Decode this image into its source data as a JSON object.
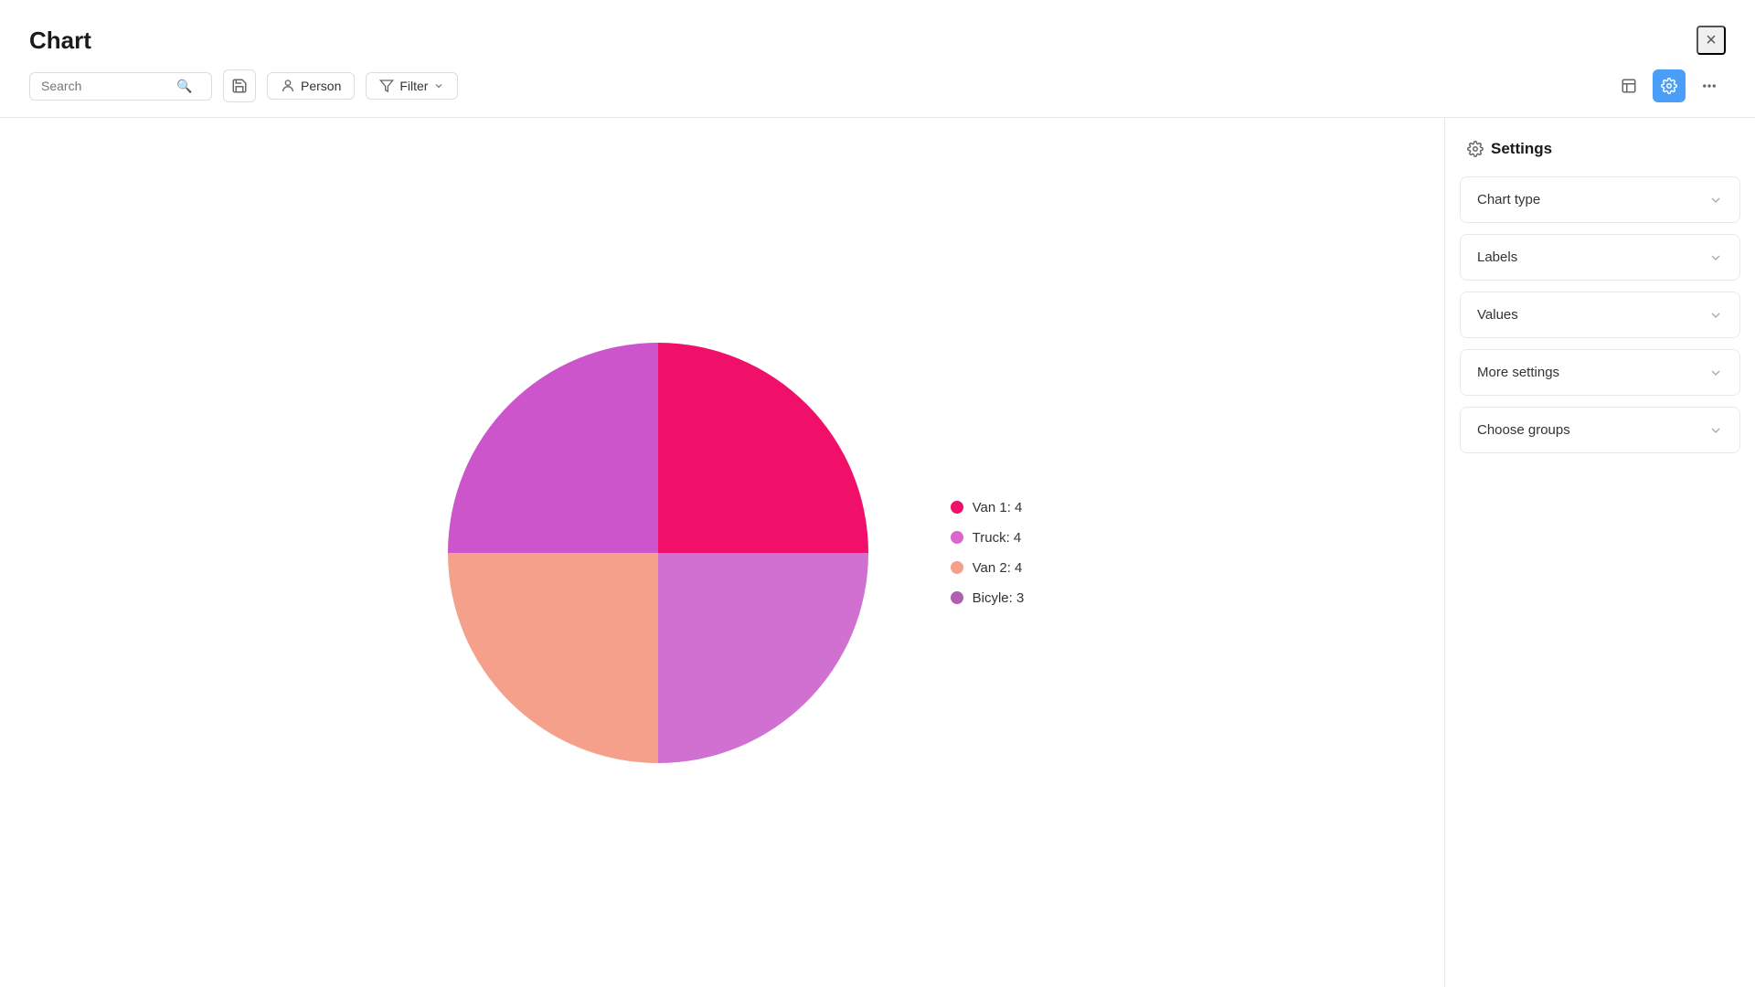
{
  "header": {
    "title": "Chart",
    "close_label": "×"
  },
  "toolbar": {
    "search_placeholder": "Search",
    "person_label": "Person",
    "filter_label": "Filter",
    "save_icon": "💾",
    "minimize_icon": "—",
    "settings_icon": "⚙",
    "more_icon": "···"
  },
  "chart": {
    "segments": [
      {
        "label": "Van 1",
        "value": 4,
        "color": "#f0106a",
        "startAngle": 0,
        "endAngle": 90
      },
      {
        "label": "Truck",
        "value": 4,
        "color": "#cc55cc",
        "startAngle": 90,
        "endAngle": 180
      },
      {
        "label": "Van 2",
        "value": 4,
        "color": "#f5a08a",
        "startAngle": 180,
        "endAngle": 270
      },
      {
        "label": "Bicyle",
        "value": 3,
        "color": "#c86fc9",
        "startAngle": 270,
        "endAngle": 360
      }
    ],
    "legend": [
      {
        "label": "Van 1: 4",
        "color": "#f0106a"
      },
      {
        "label": "Truck: 4",
        "color": "#dd66cc"
      },
      {
        "label": "Van 2: 4",
        "color": "#f5a08a"
      },
      {
        "label": "Bicyle: 3",
        "color": "#b060b0"
      }
    ]
  },
  "settings": {
    "title": "Settings",
    "sections": [
      {
        "id": "chart-type",
        "label": "Chart type"
      },
      {
        "id": "labels",
        "label": "Labels"
      },
      {
        "id": "values",
        "label": "Values"
      },
      {
        "id": "more-settings",
        "label": "More settings"
      },
      {
        "id": "choose-groups",
        "label": "Choose groups"
      }
    ]
  }
}
